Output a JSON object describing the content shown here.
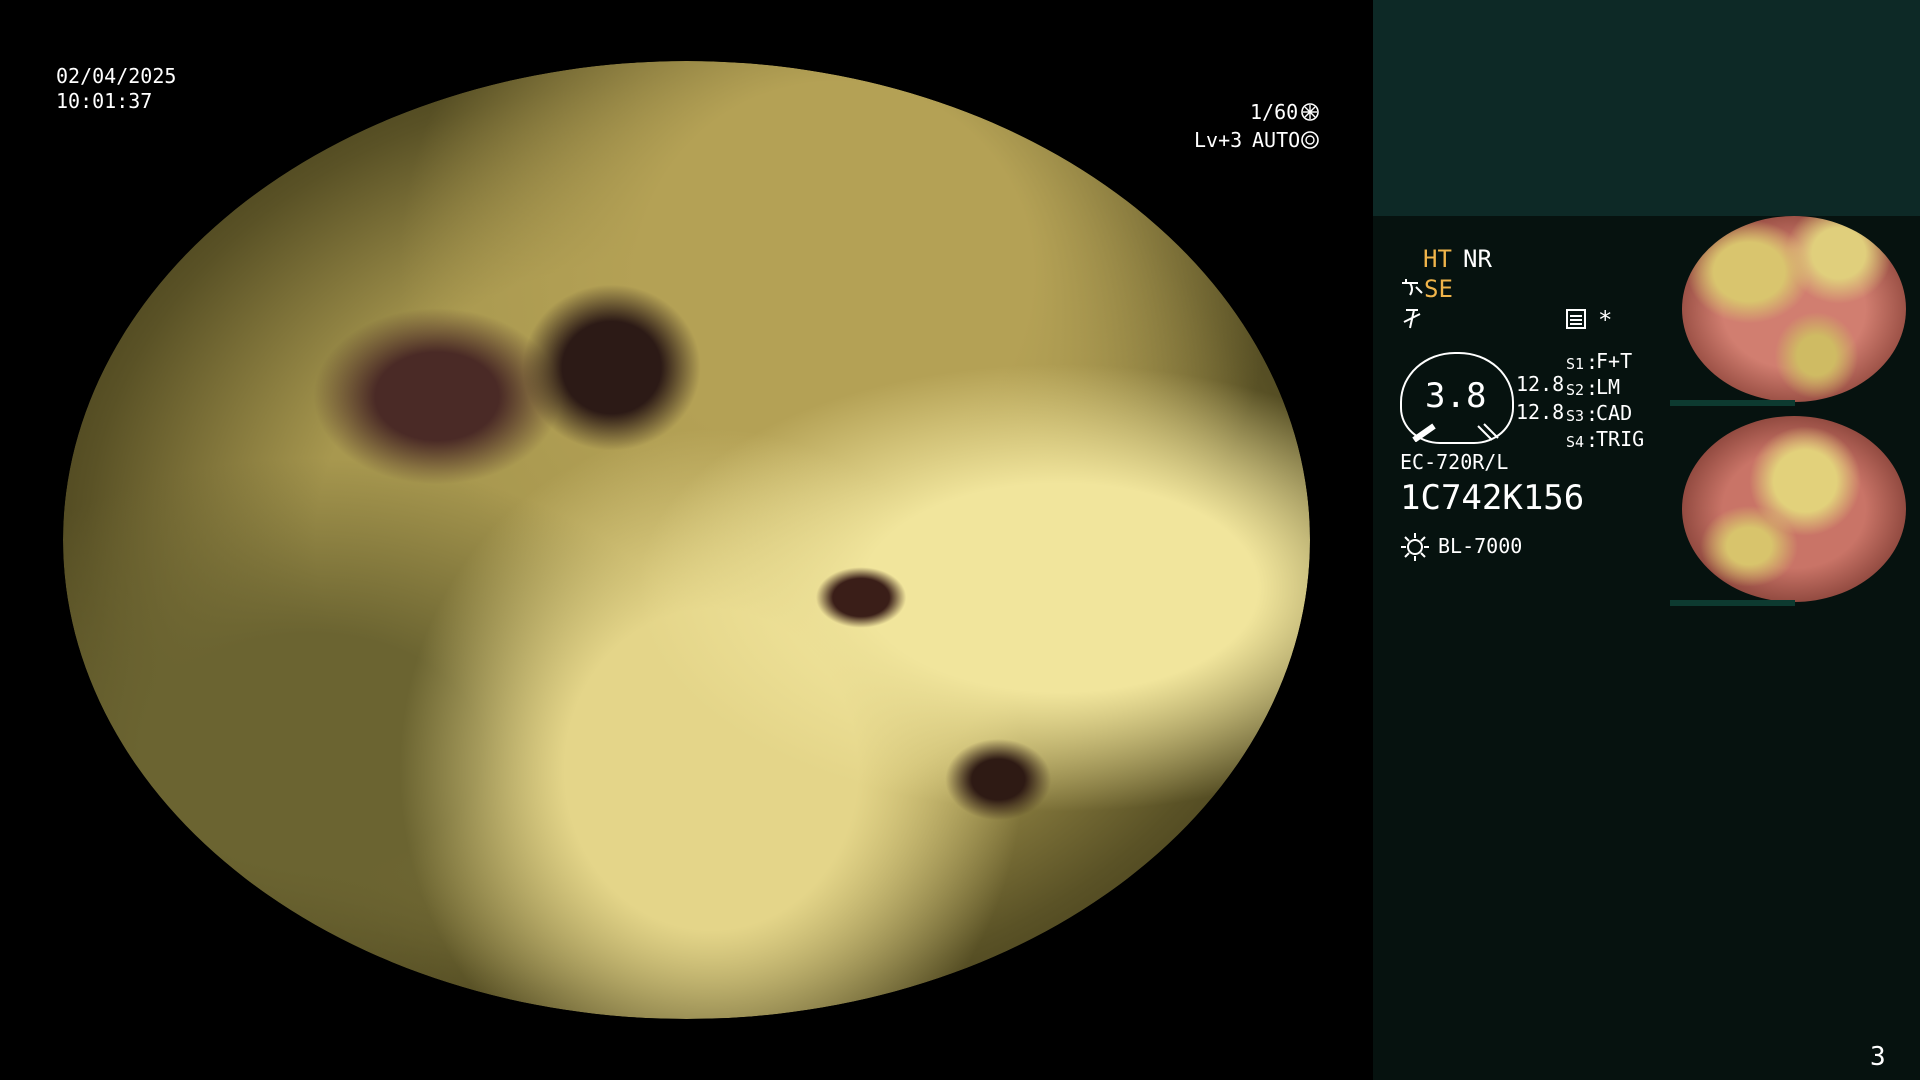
{
  "overlay": {
    "date": "02/04/2025",
    "time": "10:01:37",
    "shutter": "1/60",
    "level": "Lv+3",
    "auto": "AUTO"
  },
  "panel": {
    "ht": "HT",
    "nr": "NR",
    "se": "SE",
    "gauge_value": "3.8",
    "gauge_top": "12.8",
    "gauge_bottom": "12.8",
    "s1_label": "S1",
    "s1_value": "F+T",
    "s2_label": "S2",
    "s2_value": "LM",
    "s3_label": "S3",
    "s3_value": "CAD",
    "s4_label": "S4",
    "s4_value": "TRIG",
    "scope_model": "EC-720R/L",
    "serial": "1C742K156",
    "light_source": "BL-7000",
    "asterisk": "*"
  },
  "page_number": "3",
  "colors": {
    "panel_bg": "#06120f",
    "panel_top_bg": "#0d2926",
    "orange": "#f0b44a"
  }
}
